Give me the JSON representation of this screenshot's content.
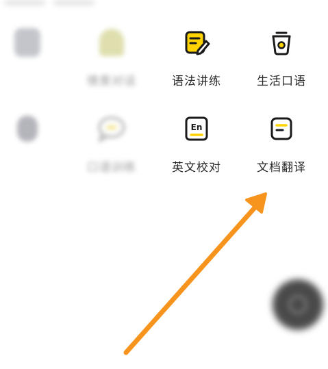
{
  "colors": {
    "accent": "#ffd400",
    "arrow": "#f7941d",
    "icon_stroke": "#1a1a1a"
  },
  "features": [
    {
      "label": "",
      "icon": "robot-icon",
      "blurred": true
    },
    {
      "label": "情景对话",
      "icon": "bell-icon",
      "blurred": true
    },
    {
      "label": "语法讲练",
      "icon": "edit-note-icon",
      "blurred": false
    },
    {
      "label": "生活口语",
      "icon": "cup-icon",
      "blurred": false
    },
    {
      "label": "",
      "icon": "person-icon",
      "blurred": true
    },
    {
      "label": "口语训练",
      "icon": "chat-bubble-icon",
      "blurred": true
    },
    {
      "label": "英文校对",
      "icon": "en-check-icon",
      "blurred": false
    },
    {
      "label": "文档翻译",
      "icon": "document-icon",
      "blurred": false
    }
  ]
}
